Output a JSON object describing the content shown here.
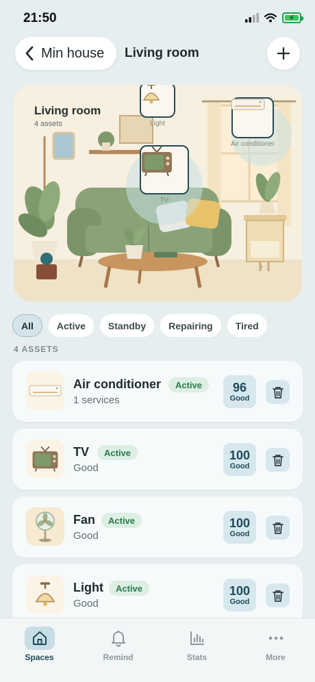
{
  "status_bar": {
    "time": "21:50"
  },
  "header": {
    "back_label": "Min house",
    "title": "Living room"
  },
  "hero": {
    "room_name": "Living room",
    "asset_count": "4 assets",
    "markers": [
      {
        "label": "Light"
      },
      {
        "label": "Air conditioner"
      },
      {
        "label": "TV"
      }
    ]
  },
  "filters": [
    "All",
    "Active",
    "Standby",
    "Repairing",
    "Tired"
  ],
  "assets_heading": "4 ASSETS",
  "assets": [
    {
      "name": "Air conditioner",
      "subtitle": "1 services",
      "status": "Active",
      "score": "96",
      "score_label": "Good",
      "icon": "air-conditioner-icon"
    },
    {
      "name": "TV",
      "subtitle": "Good",
      "status": "Active",
      "score": "100",
      "score_label": "Good",
      "icon": "tv-icon"
    },
    {
      "name": "Fan",
      "subtitle": "Good",
      "status": "Active",
      "score": "100",
      "score_label": "Good",
      "icon": "fan-icon"
    },
    {
      "name": "Light",
      "subtitle": "Good",
      "status": "Active",
      "score": "100",
      "score_label": "Good",
      "icon": "lamp-icon"
    }
  ],
  "nav": [
    {
      "label": "Spaces",
      "icon": "home-icon",
      "active": true
    },
    {
      "label": "Remind",
      "icon": "bell-icon",
      "active": false
    },
    {
      "label": "Stats",
      "icon": "bar-chart-icon",
      "active": false
    },
    {
      "label": "More",
      "icon": "more-icon",
      "active": false
    }
  ],
  "colors": {
    "accent": "#1e4a59",
    "status_active_bg": "#dcefe2",
    "status_active_text": "#2a7a4d",
    "background": "#e7eef0"
  }
}
